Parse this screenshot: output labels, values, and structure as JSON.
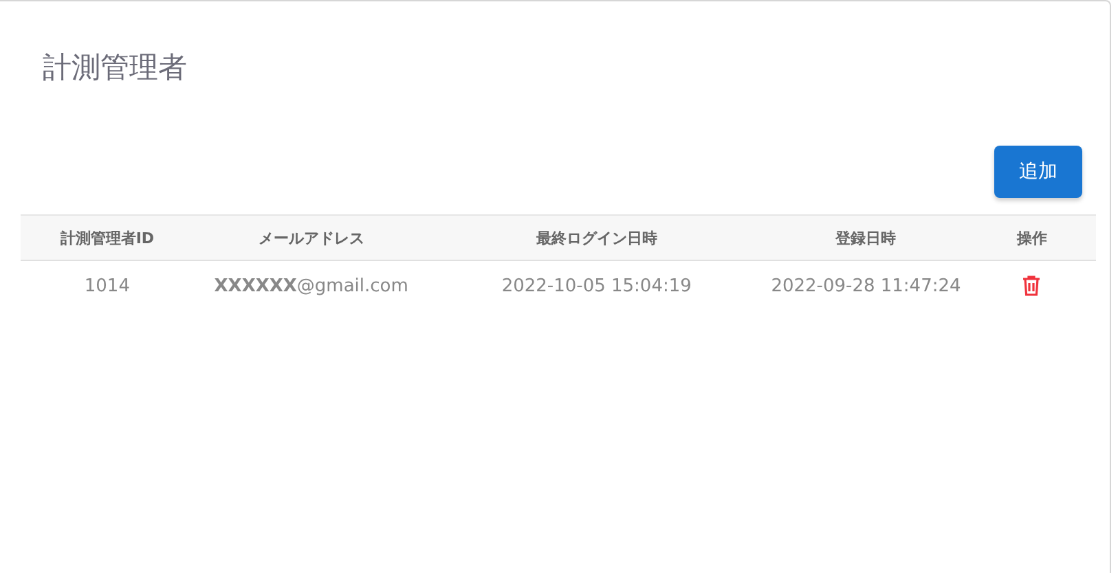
{
  "title": "計測管理者",
  "add_button": "追加",
  "table": {
    "columns": [
      "計測管理者ID",
      "メールアドレス",
      "最終ログイン日時",
      "登録日時",
      "操作"
    ],
    "rows": [
      {
        "id": "1014",
        "email": "**XXXXXX**@gmail.com",
        "last_login": "2022-10-05 15:04:19",
        "registered": "2022-09-28 11:47:24"
      }
    ]
  }
}
